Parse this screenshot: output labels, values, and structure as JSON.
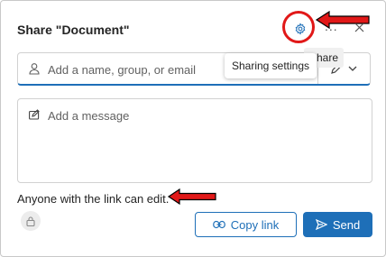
{
  "dialog": {
    "title": "Share \"Document\"",
    "more_label": "...",
    "close_label": "×"
  },
  "tooltips": {
    "share": "Share",
    "sharing_settings": "Sharing settings"
  },
  "recipients": {
    "placeholder": "Add a name, group, or email",
    "permission_icon": "pencil-icon"
  },
  "message": {
    "placeholder": "Add a message"
  },
  "link_status": "Anyone with the link can edit.",
  "actions": {
    "copy_link": "Copy link",
    "send": "Send"
  },
  "colors": {
    "accent": "#1e6fb8",
    "annotation": "#e11818"
  }
}
